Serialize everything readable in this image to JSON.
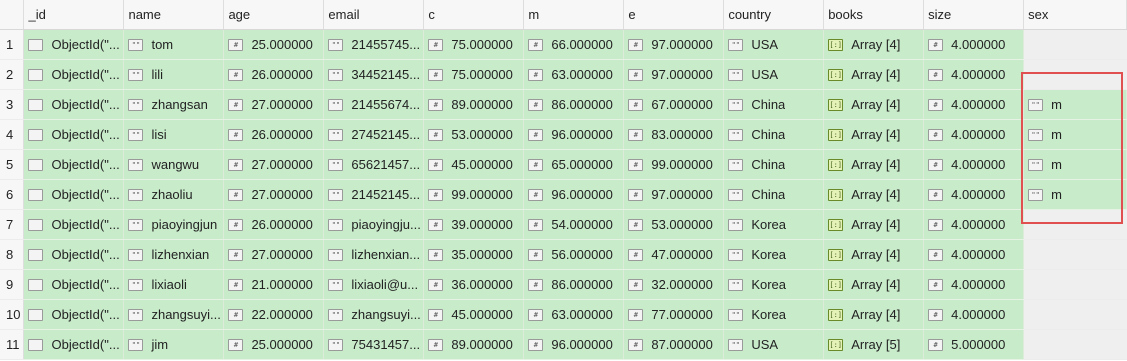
{
  "columns": [
    "_id",
    "name",
    "age",
    "email",
    "c",
    "m",
    "e",
    "country",
    "books",
    "size",
    "sex"
  ],
  "icons": {
    "_id": "object-icon",
    "name": "string-icon",
    "age": "number-icon",
    "email": "string-icon",
    "c": "number-icon",
    "m": "number-icon",
    "e": "number-icon",
    "country": "string-icon",
    "books": "array-icon",
    "size": "number-icon",
    "sex": "string-icon"
  },
  "icon_glyphs": {
    "object-icon": "",
    "string-icon": "\"\"",
    "number-icon": "#",
    "array-icon": "[:]"
  },
  "rows": [
    {
      "n": "1",
      "_id": "ObjectId(\"...",
      "name": "tom",
      "age": "25.000000",
      "email": "21455745...",
      "c": "75.000000",
      "m": "66.000000",
      "e": "97.000000",
      "country": "USA",
      "books": "Array [4]",
      "size": "4.000000",
      "sex": ""
    },
    {
      "n": "2",
      "_id": "ObjectId(\"...",
      "name": "lili",
      "age": "26.000000",
      "email": "34452145...",
      "c": "75.000000",
      "m": "63.000000",
      "e": "97.000000",
      "country": "USA",
      "books": "Array [4]",
      "size": "4.000000",
      "sex": ""
    },
    {
      "n": "3",
      "_id": "ObjectId(\"...",
      "name": "zhangsan",
      "age": "27.000000",
      "email": "21455674...",
      "c": "89.000000",
      "m": "86.000000",
      "e": "67.000000",
      "country": "China",
      "books": "Array [4]",
      "size": "4.000000",
      "sex": "m"
    },
    {
      "n": "4",
      "_id": "ObjectId(\"...",
      "name": "lisi",
      "age": "26.000000",
      "email": "27452145...",
      "c": "53.000000",
      "m": "96.000000",
      "e": "83.000000",
      "country": "China",
      "books": "Array [4]",
      "size": "4.000000",
      "sex": "m"
    },
    {
      "n": "5",
      "_id": "ObjectId(\"...",
      "name": "wangwu",
      "age": "27.000000",
      "email": "65621457...",
      "c": "45.000000",
      "m": "65.000000",
      "e": "99.000000",
      "country": "China",
      "books": "Array [4]",
      "size": "4.000000",
      "sex": "m"
    },
    {
      "n": "6",
      "_id": "ObjectId(\"...",
      "name": "zhaoliu",
      "age": "27.000000",
      "email": "21452145...",
      "c": "99.000000",
      "m": "96.000000",
      "e": "97.000000",
      "country": "China",
      "books": "Array [4]",
      "size": "4.000000",
      "sex": "m"
    },
    {
      "n": "7",
      "_id": "ObjectId(\"...",
      "name": "piaoyingjun",
      "age": "26.000000",
      "email": "piaoyingju...",
      "c": "39.000000",
      "m": "54.000000",
      "e": "53.000000",
      "country": "Korea",
      "books": "Array [4]",
      "size": "4.000000",
      "sex": ""
    },
    {
      "n": "8",
      "_id": "ObjectId(\"...",
      "name": "lizhenxian",
      "age": "27.000000",
      "email": "lizhenxian...",
      "c": "35.000000",
      "m": "56.000000",
      "e": "47.000000",
      "country": "Korea",
      "books": "Array [4]",
      "size": "4.000000",
      "sex": ""
    },
    {
      "n": "9",
      "_id": "ObjectId(\"...",
      "name": "lixiaoli",
      "age": "21.000000",
      "email": "lixiaoli@u...",
      "c": "36.000000",
      "m": "86.000000",
      "e": "32.000000",
      "country": "Korea",
      "books": "Array [4]",
      "size": "4.000000",
      "sex": ""
    },
    {
      "n": "10",
      "_id": "ObjectId(\"...",
      "name": "zhangsuyi...",
      "age": "22.000000",
      "email": "zhangsuyi...",
      "c": "45.000000",
      "m": "63.000000",
      "e": "77.000000",
      "country": "Korea",
      "books": "Array [4]",
      "size": "4.000000",
      "sex": ""
    },
    {
      "n": "11",
      "_id": "ObjectId(\"...",
      "name": "jim",
      "age": "25.000000",
      "email": "75431457...",
      "c": "89.000000",
      "m": "96.000000",
      "e": "87.000000",
      "country": "USA",
      "books": "Array [5]",
      "size": "5.000000",
      "sex": ""
    }
  ],
  "colors": {
    "filled_cell": "#c8ebca",
    "empty_cell": "#efefef",
    "header_bg": "#f7f7f7",
    "highlight_border": "#e05050"
  }
}
